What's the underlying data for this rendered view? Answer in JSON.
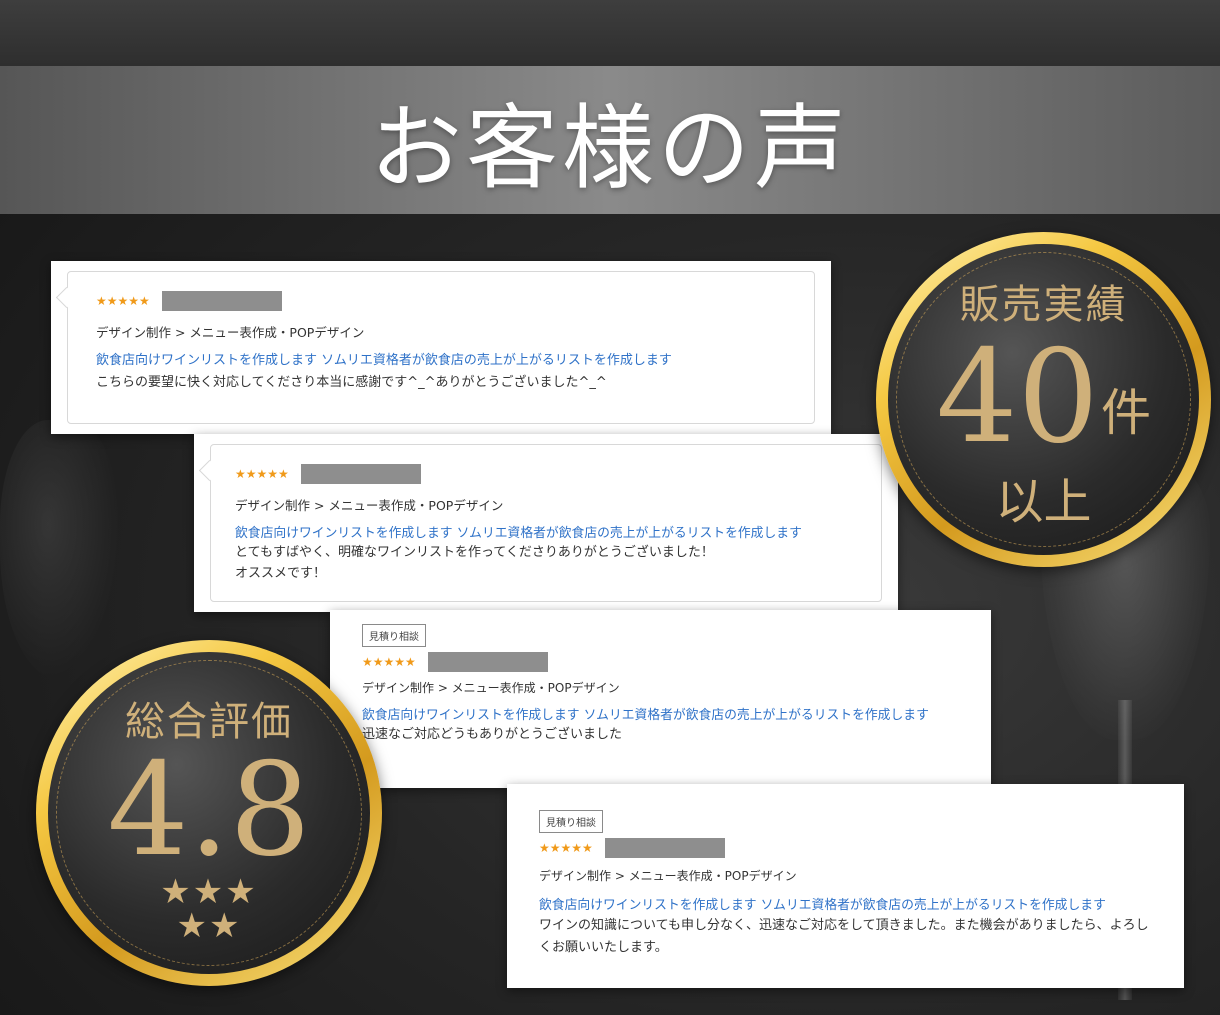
{
  "title": "お客様の声",
  "reviews": [
    {
      "stars": "★★★★★",
      "tag": "",
      "breadcrumb": "デザイン制作 > メニュー表作成・POPデザイン",
      "link": "飲食店向けワインリストを作成します ソムリエ資格者が飲食店の売上が上がるリストを作成します",
      "comment": "こちらの要望に快く対応してくださり本当に感謝です^_^ありがとうございました^_^"
    },
    {
      "stars": "★★★★★",
      "tag": "",
      "breadcrumb": "デザイン制作 > メニュー表作成・POPデザイン",
      "link": "飲食店向けワインリストを作成します ソムリエ資格者が飲食店の売上が上がるリストを作成します",
      "comment": "とてもすばやく、明確なワインリストを作ってくださりありがとうございました！\nオススメです！"
    },
    {
      "stars": "★★★★★",
      "tag": "見積り相談",
      "breadcrumb": "デザイン制作 > メニュー表作成・POPデザイン",
      "link": "飲食店向けワインリストを作成します ソムリエ資格者が飲食店の売上が上がるリストを作成します",
      "comment": "迅速なご対応どうもありがとうございました"
    },
    {
      "stars": "★★★★★",
      "tag": "見積り相談",
      "breadcrumb": "デザイン制作 > メニュー表作成・POPデザイン",
      "link": "飲食店向けワインリストを作成します ソムリエ資格者が飲食店の売上が上がるリストを作成します",
      "comment": "ワインの知識についても申し分なく、迅速なご対応をして頂きました。また機会がありましたら、よろしくお願いいたします。"
    }
  ],
  "sales_badge": {
    "label": "販売実績",
    "number": "40",
    "unit": "件",
    "suffix": "以上"
  },
  "rating_badge": {
    "label": "総合評価",
    "value": "4.8",
    "stars_row1": "★★★",
    "stars_row2": "★★"
  },
  "colors": {
    "link": "#2f72c8",
    "star": "#f09a1a",
    "gold_text": "#cfb07a",
    "gold_ring": "#f5c842"
  }
}
